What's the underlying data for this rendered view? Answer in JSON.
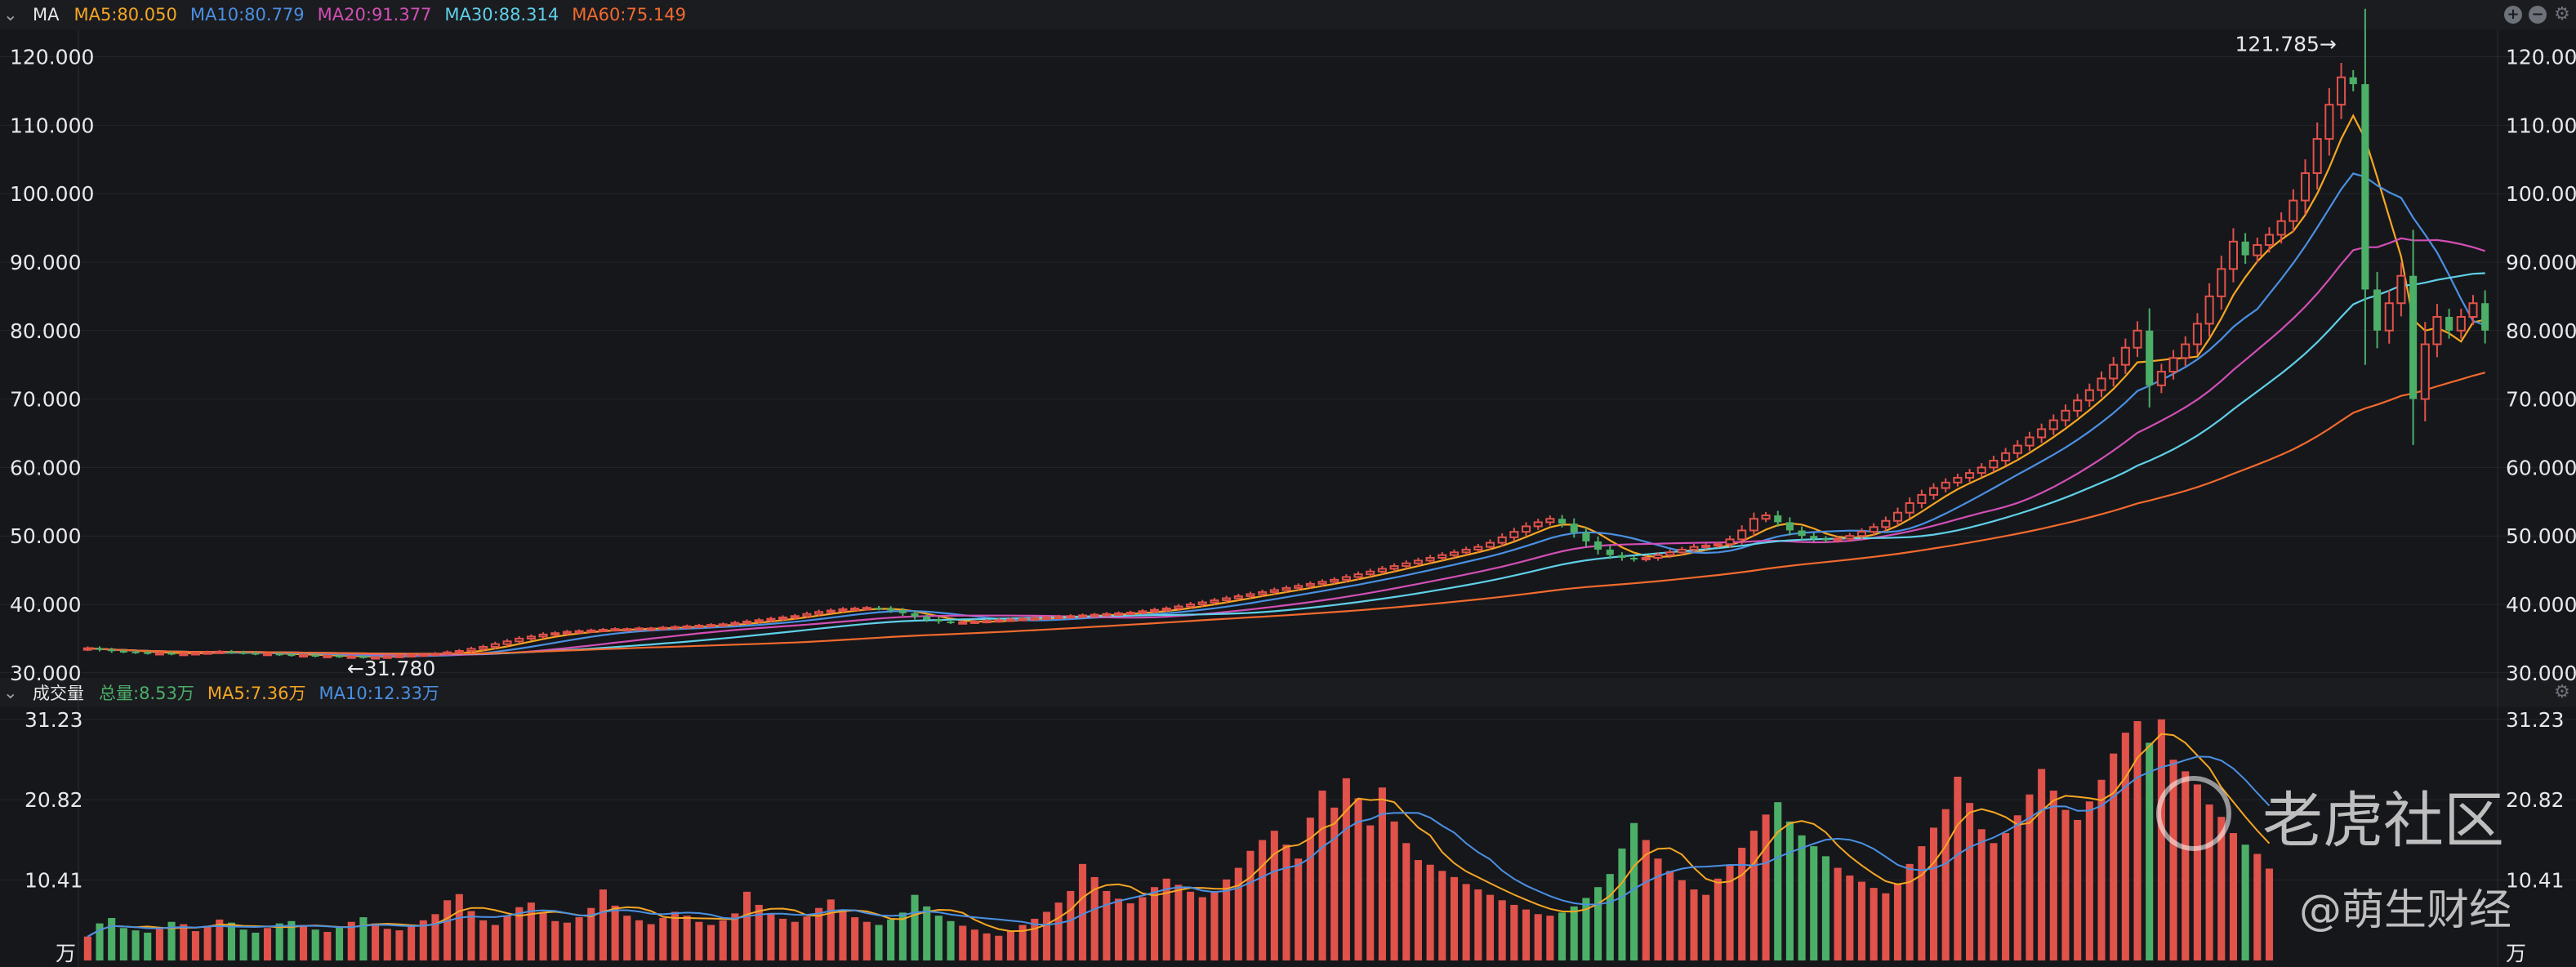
{
  "ma_legend": {
    "title": "MA",
    "items": [
      {
        "label": "MA5:80.050",
        "color": "#f5a623"
      },
      {
        "label": "MA10:80.779",
        "color": "#4a90e2"
      },
      {
        "label": "MA20:91.377",
        "color": "#d24fb5"
      },
      {
        "label": "MA30:88.314",
        "color": "#5fd0e8"
      },
      {
        "label": "MA60:75.149",
        "color": "#f26a2e"
      }
    ]
  },
  "vol_legend": {
    "title": "成交量",
    "items": [
      {
        "label": "总量:8.53万",
        "color": "#4caf68"
      },
      {
        "label": "MA5:7.36万",
        "color": "#f5a623"
      },
      {
        "label": "MA10:12.33万",
        "color": "#4a90e2"
      }
    ]
  },
  "annotations": {
    "high": "121.785→",
    "low": "←31.780"
  },
  "watermark": {
    "brand": "老虎社区",
    "author": "@萌生财经"
  },
  "chart_data": [
    {
      "type": "candlestick",
      "title": "",
      "price_ticks": [
        "30.000",
        "40.000",
        "50.000",
        "60.000",
        "70.000",
        "80.000",
        "90.000",
        "100.000",
        "110.000",
        "120.000"
      ],
      "ylim": [
        29.5,
        124
      ],
      "up_color": "#e0524a",
      "down_color": "#4caf68",
      "grid": true,
      "closes": [
        33.6,
        33.4,
        33.2,
        33.1,
        33.0,
        32.9,
        32.9,
        32.8,
        32.8,
        32.9,
        33.0,
        33.1,
        33.0,
        32.9,
        32.8,
        32.8,
        32.7,
        32.6,
        32.6,
        32.5,
        32.5,
        32.4,
        32.4,
        32.3,
        32.3,
        32.4,
        32.5,
        32.6,
        32.7,
        32.8,
        33.0,
        33.2,
        33.5,
        33.8,
        34.2,
        34.6,
        35.0,
        35.3,
        35.6,
        35.8,
        36.0,
        36.1,
        36.2,
        36.3,
        36.4,
        36.4,
        36.5,
        36.5,
        36.6,
        36.7,
        36.8,
        36.9,
        37.0,
        37.1,
        37.3,
        37.5,
        37.7,
        37.9,
        38.1,
        38.3,
        38.6,
        38.9,
        39.1,
        39.3,
        39.4,
        39.5,
        39.4,
        39.1,
        38.7,
        38.2,
        37.8,
        37.5,
        37.4,
        37.4,
        37.5,
        37.6,
        37.7,
        37.8,
        37.9,
        38.0,
        38.1,
        38.2,
        38.3,
        38.4,
        38.5,
        38.6,
        38.7,
        38.8,
        39.0,
        39.2,
        39.4,
        39.7,
        40.0,
        40.3,
        40.6,
        40.9,
        41.2,
        41.5,
        41.8,
        42.1,
        42.4,
        42.7,
        43.0,
        43.3,
        43.6,
        44.0,
        44.4,
        44.8,
        45.2,
        45.6,
        46.0,
        46.4,
        46.8,
        47.2,
        47.6,
        48.0,
        48.4,
        49.0,
        49.8,
        50.6,
        51.4,
        52.0,
        52.5,
        51.8,
        50.5,
        49.2,
        48.0,
        47.2,
        46.8,
        46.6,
        46.8,
        47.2,
        47.6,
        48.0,
        48.4,
        48.6,
        48.8,
        49.5,
        50.8,
        52.5,
        53.0,
        52.0,
        50.8,
        50.0,
        49.6,
        49.4,
        49.6,
        50.0,
        50.6,
        51.3,
        52.2,
        53.4,
        54.8,
        56.0,
        57.0,
        57.8,
        58.5,
        59.2,
        60.0,
        61.0,
        62.1,
        63.2,
        64.4,
        65.6,
        66.9,
        68.3,
        69.8,
        71.3,
        73.0,
        75.0,
        77.5,
        80.0,
        72.0,
        74.0,
        76.0,
        78.0,
        81.0,
        85.0,
        89.0,
        93.0,
        91.0,
        92.5,
        94.0,
        96.0,
        99.0,
        103.0,
        108.0,
        113.0,
        117.0,
        116.0,
        86.0,
        80.0,
        84.0,
        88.0,
        70.0,
        78.0,
        82.0,
        80.0,
        82.0,
        84.0,
        80.0
      ]
    },
    {
      "type": "bar",
      "title": "",
      "unit": "万",
      "volume_ticks": [
        "10.41",
        "20.82",
        "31.23"
      ],
      "ylim": [
        0,
        31.23
      ],
      "values": [
        3.1,
        4.8,
        5.5,
        4.2,
        3.9,
        3.6,
        4.1,
        5.0,
        4.7,
        3.8,
        4.4,
        5.3,
        4.9,
        4.0,
        3.6,
        4.2,
        4.8,
        5.1,
        4.6,
        4.0,
        3.7,
        4.3,
        5.0,
        5.6,
        4.8,
        4.1,
        3.9,
        4.4,
        5.2,
        6.0,
        7.8,
        8.6,
        6.4,
        5.2,
        4.6,
        5.8,
        6.9,
        7.5,
        6.2,
        5.1,
        4.9,
        5.6,
        6.8,
        9.2,
        7.1,
        5.8,
        5.2,
        4.7,
        5.5,
        6.3,
        5.8,
        5.0,
        4.6,
        5.2,
        6.1,
        8.9,
        7.2,
        6.0,
        5.4,
        5.0,
        5.7,
        6.8,
        7.9,
        6.5,
        5.6,
        5.0,
        4.6,
        5.3,
        6.2,
        8.5,
        7.0,
        5.8,
        5.1,
        4.5,
        4.0,
        3.5,
        3.2,
        3.8,
        4.6,
        5.4,
        6.3,
        7.5,
        9.0,
        12.5,
        10.8,
        9.0,
        8.0,
        7.4,
        8.2,
        9.5,
        10.6,
        9.8,
        8.9,
        8.2,
        9.0,
        10.5,
        12.0,
        14.2,
        15.6,
        16.8,
        15.0,
        13.2,
        18.5,
        22.0,
        19.8,
        23.6,
        21.0,
        17.5,
        22.4,
        18.0,
        15.2,
        13.0,
        12.4,
        11.6,
        10.8,
        9.9,
        9.2,
        8.5,
        7.8,
        7.2,
        6.6,
        6.0,
        5.8,
        6.2,
        7.0,
        8.1,
        9.5,
        11.2,
        14.5,
        17.8,
        15.6,
        13.2,
        11.6,
        10.4,
        9.2,
        8.5,
        10.6,
        12.4,
        14.6,
        16.8,
        18.9,
        20.5,
        18.0,
        16.2,
        14.8,
        13.5,
        12.0,
        11.0,
        10.2,
        9.4,
        8.7,
        10.0,
        12.5,
        14.8,
        17.2,
        19.6,
        23.8,
        20.4,
        17.0,
        15.2,
        16.5,
        18.8,
        21.5,
        24.8,
        22.0,
        19.5,
        18.2,
        20.6,
        23.4,
        26.8,
        29.5,
        31.0,
        28.2,
        31.23,
        26.0,
        24.5,
        22.8,
        20.2,
        18.6,
        16.5,
        15.0,
        13.8,
        11.9
      ]
    }
  ]
}
